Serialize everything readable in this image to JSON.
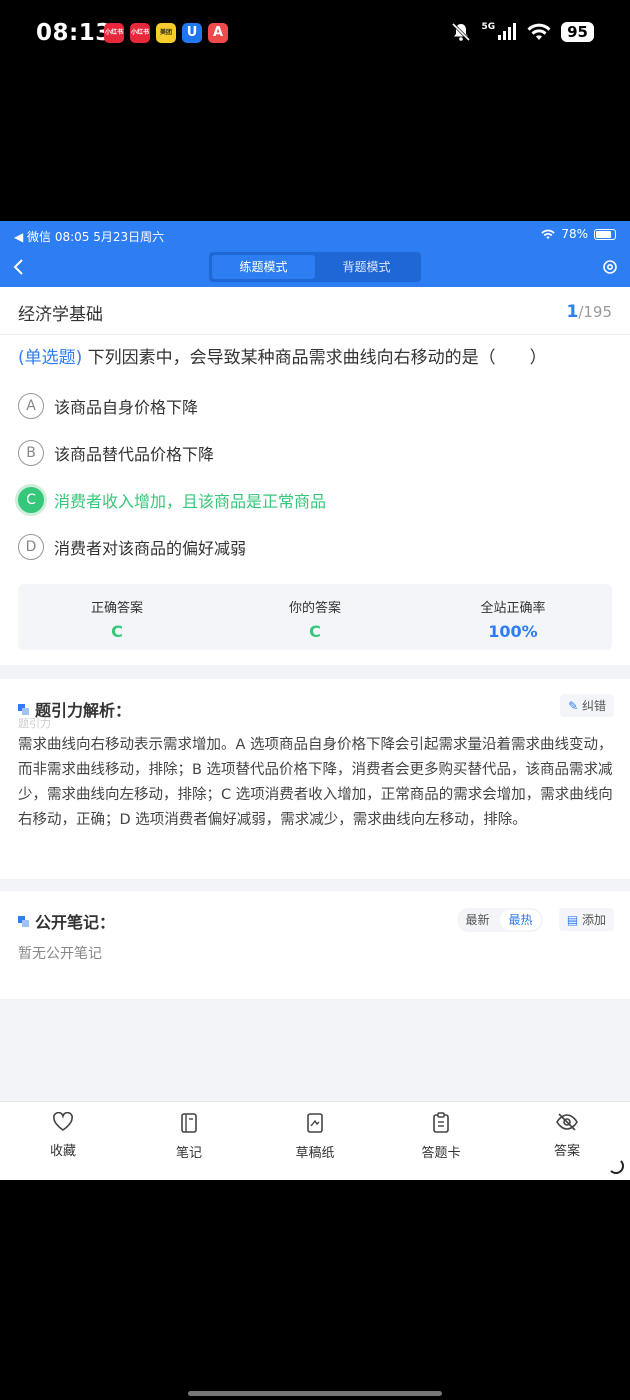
{
  "phone_status": {
    "time": "08:13",
    "apps": [
      {
        "label": "小红书",
        "color": "#e8273b"
      },
      {
        "label": "小红书",
        "color": "#e8273b"
      },
      {
        "label": "美团",
        "color": "#f8cd2b"
      },
      {
        "label": "U",
        "color": "#1e76f0"
      },
      {
        "label": "A",
        "color": "#f04a4a"
      }
    ],
    "network": "5G",
    "battery": "95"
  },
  "tablet_status": {
    "left": "◀ 微信   08:05   5月23日周六",
    "battery_pct": "78%"
  },
  "nav": {
    "tabs": [
      {
        "label": "练题模式",
        "active": true
      },
      {
        "label": "背题模式",
        "active": false
      }
    ]
  },
  "header": {
    "subject": "经济学基础",
    "current": "1",
    "total": "/195"
  },
  "question": {
    "type": "(单选题)",
    "text": "下列因素中，会导致某种商品需求曲线向右移动的是（　　）",
    "options": [
      {
        "letter": "A",
        "text": "该商品自身价格下降",
        "correct": false
      },
      {
        "letter": "B",
        "text": "该商品替代品价格下降",
        "correct": false
      },
      {
        "letter": "C",
        "text": "消费者收入增加，且该商品是正常商品",
        "correct": true
      },
      {
        "letter": "D",
        "text": "消费者对该商品的偏好减弱",
        "correct": false
      }
    ]
  },
  "answer": {
    "correct_label": "正确答案",
    "correct_value": "C",
    "yours_label": "你的答案",
    "yours_value": "C",
    "rate_label": "全站正确率",
    "rate_value": "100%"
  },
  "analysis": {
    "title": "题引力解析：",
    "watermark": "题引力",
    "report_label": "纠错",
    "text": "需求曲线向右移动表示需求增加。A 选项商品自身价格下降会引起需求量沿着需求曲线变动，而非需求曲线移动，排除；B 选项替代品价格下降，消费者会更多购买替代品，该商品需求减少，需求曲线向左移动，排除；C 选项消费者收入增加，正常商品的需求会增加，需求曲线向右移动，正确；D 选项消费者偏好减弱，需求减少，需求曲线向左移动，排除。"
  },
  "notes": {
    "title": "公开笔记：",
    "sort_latest": "最新",
    "sort_hot": "最热",
    "add_label": "添加",
    "empty": "暂无公开笔记"
  },
  "bottom_bar": [
    {
      "icon": "heart-icon",
      "label": "收藏"
    },
    {
      "icon": "notebook-icon",
      "label": "笔记"
    },
    {
      "icon": "draft-paper-icon",
      "label": "草稿纸"
    },
    {
      "icon": "answer-sheet-icon",
      "label": "答题卡"
    },
    {
      "icon": "eye-off-icon",
      "label": "答案"
    }
  ]
}
